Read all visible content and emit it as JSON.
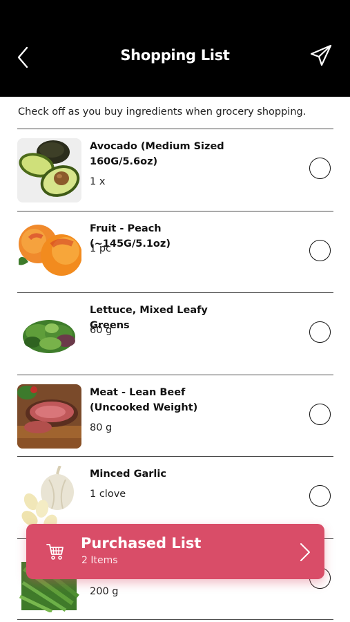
{
  "header": {
    "title": "Shopping List",
    "back_icon": "chevron-left-icon",
    "send_icon": "paper-plane-icon"
  },
  "subtitle": "Check off as you buy ingredients when grocery shopping.",
  "items": [
    {
      "name": "Avocado (Medium Sized 160G/5.6oz)",
      "qty": "1 x",
      "image": "avocado",
      "checked": false
    },
    {
      "name": "Fruit - Peach (~145G/5.1oz)",
      "qty": "1 pc",
      "image": "peach",
      "checked": false
    },
    {
      "name": "Lettuce, Mixed Leafy Greens",
      "qty": "60 g",
      "image": "lettuce",
      "checked": false
    },
    {
      "name": "Meat - Lean Beef (Uncooked Weight)",
      "qty": "80 g",
      "image": "beef",
      "checked": false
    },
    {
      "name": "Minced Garlic",
      "qty": "1 clove",
      "image": "garlic",
      "checked": false
    },
    {
      "name": "",
      "qty": "200 g",
      "image": "green-beans",
      "checked": false
    }
  ],
  "purchased": {
    "title": "Purchased List",
    "count": "2 Items",
    "icon": "shopping-cart-icon",
    "color": "#d94d68"
  }
}
